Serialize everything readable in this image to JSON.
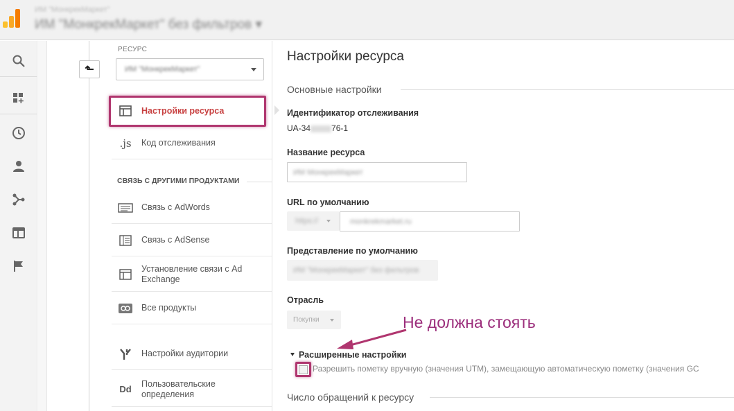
{
  "header": {
    "account_sub": "ИМ \"МонкрекМаркет\"",
    "account_name": "ИМ \"МонкрекМаркет\" без фильтров"
  },
  "colors": {
    "accent": "#c84141",
    "highlight": "#b0366f",
    "logo_orange": "#f57c00",
    "logo_yellow": "#fbc02d"
  },
  "nav_icons": [
    "search-icon",
    "dashboard-icon",
    "clock-icon",
    "person-icon",
    "share-icon",
    "display-icon",
    "flag-icon"
  ],
  "property": {
    "label": "РЕСУРС",
    "selected": "ИМ \"МонкрекМаркет\""
  },
  "menu": {
    "items": [
      {
        "label": "Настройки ресурса",
        "icon": "layout-icon"
      },
      {
        "label": "Код отслеживания",
        "icon": "js-icon"
      }
    ],
    "section_title": "СВЯЗЬ С ДРУГИМИ ПРОДУКТАМИ",
    "products": [
      {
        "label": "Связь с AdWords",
        "icon": "adwords-icon"
      },
      {
        "label": "Связь с AdSense",
        "icon": "adsense-icon"
      },
      {
        "label": "Установление связи с Ad Exchange",
        "icon": "adexchange-icon"
      },
      {
        "label": "Все продукты",
        "icon": "link-icon"
      }
    ],
    "audience": {
      "label": "Настройки аудитории",
      "icon": "audience-icon"
    },
    "custom": {
      "label": "Пользовательские определения",
      "icon": "dd-icon"
    }
  },
  "main": {
    "title": "Настройки ресурса",
    "basic_settings": "Основные настройки",
    "tracking_id_label": "Идентификатор отслеживания",
    "tracking_id_prefix": "UA-34",
    "tracking_id_suffix": "76-1",
    "property_name_label": "Название ресурса",
    "property_name_value": "ИМ МонкрекМаркет",
    "default_url_label": "URL по умолчанию",
    "protocol": "https://",
    "default_url_value": "monkrekmarket.ru",
    "default_view_label": "Представление по умолчанию",
    "default_view_value": "ИМ \"МонкрекМаркет\" без фильтров",
    "industry_label": "Отрасль",
    "industry_value": "Покупки",
    "annotation": "Не должна стоять",
    "advanced_settings": "Расширенные настройки",
    "manual_tagging_label": "Разрешить пометку вручную (значения UTM), замещающую автоматическую пометку (значения GC",
    "hits_section": "Число обращений к ресурсу"
  }
}
